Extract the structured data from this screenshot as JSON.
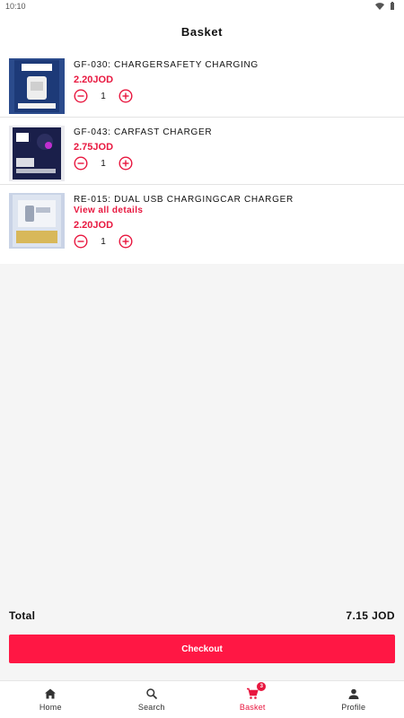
{
  "status_bar": {
    "time": "10:10"
  },
  "header": {
    "title": "Basket"
  },
  "items": [
    {
      "name": "GF-030: CHARGERSAFETY CHARGING",
      "price": "2.20JOD",
      "quantity": "1",
      "image": "charger-box"
    },
    {
      "name": "GF-043: CARFAST CHARGER",
      "price": "2.75JOD",
      "quantity": "1",
      "image": "car-charger-box"
    },
    {
      "name": "RE-015: DUAL USB CHARGINGCAR CHARGER",
      "details_link": "View all details",
      "price": "2.20JOD",
      "quantity": "1",
      "image": "usb-car-charger-pack"
    }
  ],
  "summary": {
    "total_label": "Total",
    "total_value": "7.15 JOD"
  },
  "checkout": {
    "label": "Checkout"
  },
  "nav": {
    "home": "Home",
    "search": "Search",
    "basket": "Basket",
    "basket_badge": "3",
    "profile": "Profile"
  },
  "colors": {
    "accent": "#ff1744",
    "price": "#e8173f"
  }
}
